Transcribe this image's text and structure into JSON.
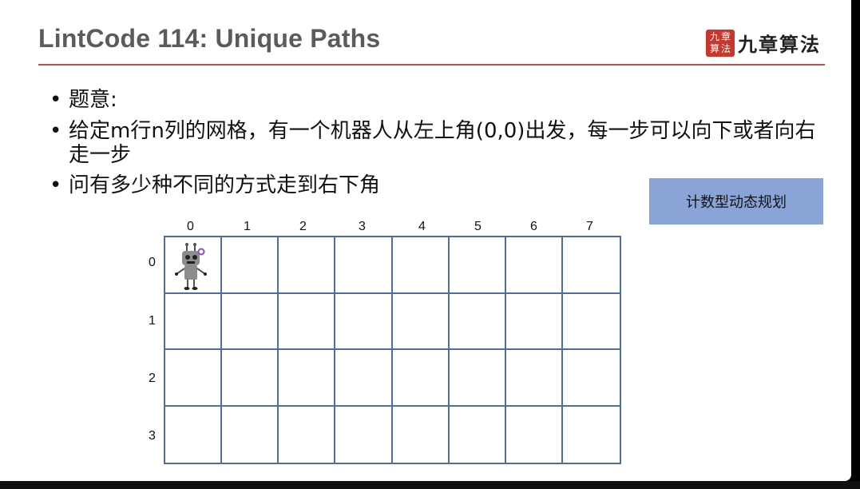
{
  "slide": {
    "title": "LintCode 114: Unique Paths",
    "logo": {
      "seal_chars": [
        "九",
        "章",
        "算",
        "法"
      ],
      "text": "九章算法"
    },
    "bullets": [
      "题意:",
      "给定m行n列的网格，有一个机器人从左上角(0,0)出发，每一步可以向下或者向右走一步",
      "问有多少种不同的方式走到右下角"
    ],
    "badge": "计数型动态规划",
    "grid": {
      "columns": [
        "0",
        "1",
        "2",
        "3",
        "4",
        "5",
        "6",
        "7"
      ],
      "rows": [
        "0",
        "1",
        "2",
        "3"
      ]
    },
    "colors": {
      "title_rule": "#b8524e",
      "grid_line": "#4b6ea8",
      "badge_bg": "#8aa4d8",
      "seal": "#c8372d"
    },
    "icons": [
      "robot-icon",
      "play-watermark-icon"
    ]
  }
}
